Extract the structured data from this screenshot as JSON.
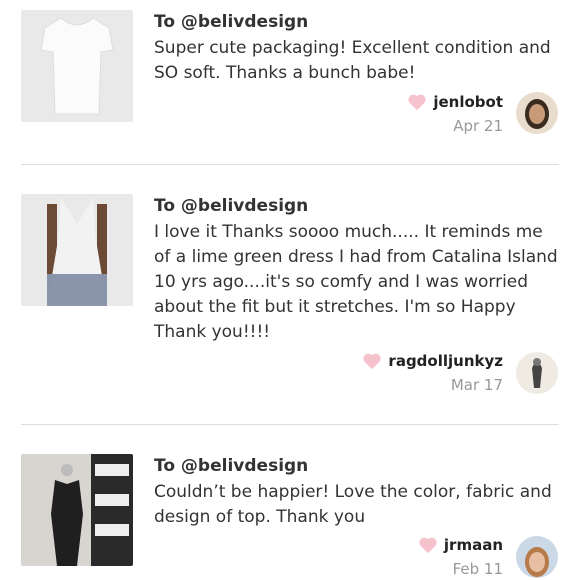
{
  "reviews": [
    {
      "to": "To @belivdesign",
      "text": "Super cute packaging! Excellent condition and SO soft. Thanks a bunch babe!",
      "username": "jenlobot",
      "date": "Apr 21"
    },
    {
      "to": "To @belivdesign",
      "text": "I love it Thanks soooo much..... It reminds me of a lime green dress I had from Catalina Island 10 yrs ago....it's so comfy and I was worried about the fit but it stretches. I'm so Happy Thank you!!!!",
      "username": "ragdolljunkyz",
      "date": "Mar 17"
    },
    {
      "to": "To @belivdesign",
      "text": "Couldn’t be happier! Love the color, fabric and design of top. Thank you",
      "username": "jrmaan",
      "date": "Feb 11"
    }
  ],
  "colors": {
    "heart": "#f6c2cb",
    "date": "#999999",
    "divider": "#dddddd"
  },
  "icons": {
    "like": "heart-icon"
  }
}
